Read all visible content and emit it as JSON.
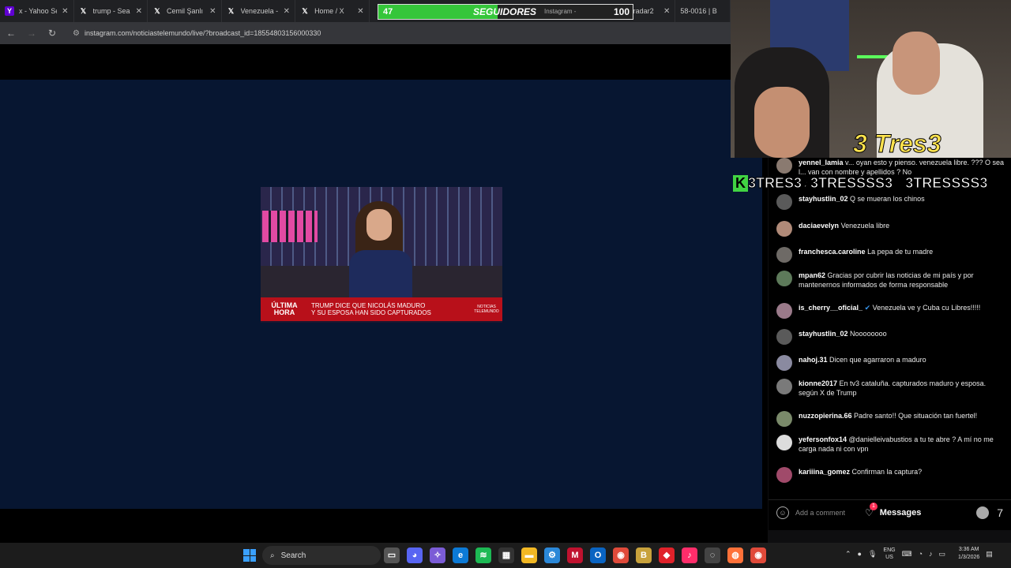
{
  "browser": {
    "tabs": [
      {
        "label": "x - Yahoo Se",
        "icon": "yahoo-icon",
        "color": "#6001d2"
      },
      {
        "label": "trump - Sea",
        "icon": "x-icon",
        "color": "#000000"
      },
      {
        "label": "Cemil Şanlı",
        "icon": "x-icon",
        "color": "#000000"
      },
      {
        "label": "Venezuela -",
        "icon": "x-icon",
        "color": "#000000"
      },
      {
        "label": "Home / X",
        "icon": "x-icon",
        "color": "#000000"
      }
    ],
    "tabs_right": [
      {
        "label": "radar2",
        "icon": "x-icon"
      },
      {
        "label": "58-0016 | B",
        "icon": "page-icon"
      }
    ],
    "ghost_tab": "Instagram -",
    "url": "instagram.com/noticiastelemundo/live/?broadcast_id=18554803156000330"
  },
  "follower_goal": {
    "current": "47",
    "label": "SEGUIDORES",
    "goal": "100",
    "progress": 0.47,
    "color": "#35c63a"
  },
  "news_frame": {
    "tag": "ÚLTIMA HORA",
    "headline_line1": "TRUMP DICE QUE NICOLÁS MADURO",
    "headline_line2": "Y SU ESPOSA HAN SIDO CAPTURADOS",
    "brand": "NOTICIAS TELEMUNDO",
    "ticker_color": "#b8101a"
  },
  "overlay": {
    "logo_text": "3 Tres3",
    "k_handle": "3TRES3",
    "tiktok_handle": "3TRESSSS3",
    "instagram_handle": "3TRESSSS3"
  },
  "chat": {
    "messages": [
      {
        "user": "yennel_lamia",
        "text": "v... oyan esto y pienso. venezuela libre. ??? O sea l... van con nombre y apellidos ? No"
      },
      {
        "user": "stayhustlin_02",
        "text": "Q se mueran los chinos"
      },
      {
        "user": "daciaevelyn",
        "text": "Venezuela libre"
      },
      {
        "user": "franchesca.caroline",
        "text": "La pepa de tu madre"
      },
      {
        "user": "mpan62",
        "text": "Gracias por cubrir las noticias de mi país y por mantenernos informados de forma responsable"
      },
      {
        "user": "is_cherry__oficial_",
        "text": "Venezuela ve y Cuba cu Libres!!!!!"
      },
      {
        "user": "stayhustlin_02",
        "text": "Noooooooo"
      },
      {
        "user": "nahoj.31",
        "text": "Dicen que agarraron a maduro"
      },
      {
        "user": "kionne2017",
        "text": "En tv3 cataluña. capturados maduro y esposa. según X de Trump"
      },
      {
        "user": "nuzzopierina.66",
        "text": "Padre santo!! Que situación tan fuertel!"
      },
      {
        "user": "yefersonfox14",
        "text": "@danielleivabustios a tu te abre ? A mí no me carga nada ni con vpn"
      },
      {
        "user": "kariiina_gomez",
        "text": "Confirman la captura?"
      }
    ],
    "composer_placeholder": "Add a comment",
    "messages_label": "Messages",
    "messages_badge": "1",
    "counter": "7"
  },
  "taskbar": {
    "search_label": "Search",
    "lang_line1": "ENG",
    "lang_line2": "US",
    "time": "3:36 AM",
    "date": "1/3/2026"
  }
}
